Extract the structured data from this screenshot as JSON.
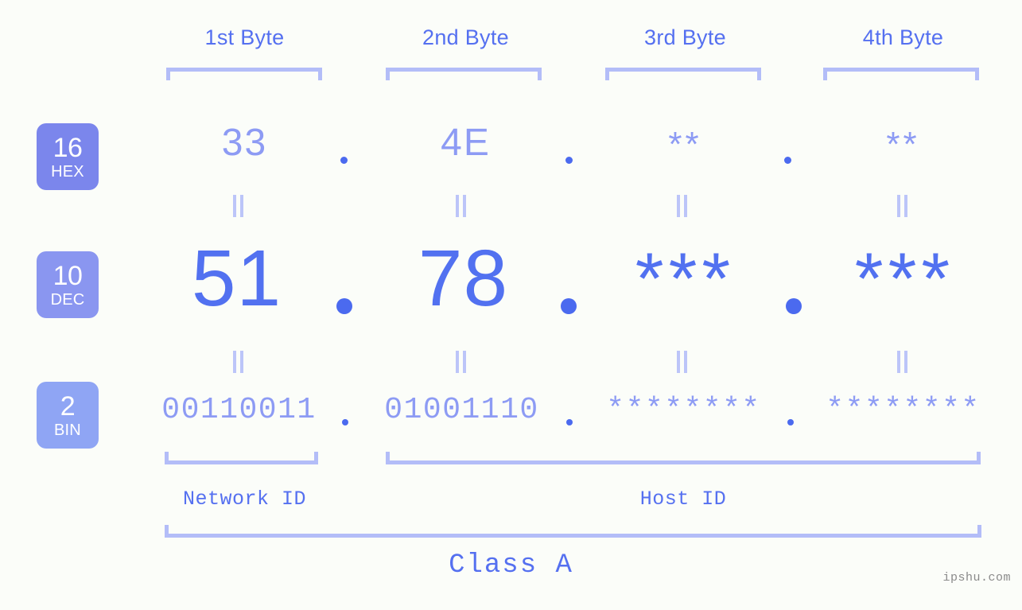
{
  "headers": [
    {
      "label": "1st Byte"
    },
    {
      "label": "2nd Byte"
    },
    {
      "label": "3rd Byte"
    },
    {
      "label": "4th Byte"
    }
  ],
  "bases": {
    "hex": {
      "number": "16",
      "name": "HEX",
      "color": "#7b86ec"
    },
    "dec": {
      "number": "10",
      "name": "DEC",
      "color": "#8a96f0"
    },
    "bin": {
      "number": "2",
      "name": "BIN",
      "color": "#8fa5f4"
    }
  },
  "rows": {
    "hex": {
      "values": [
        "33",
        "4E",
        "**",
        "**"
      ]
    },
    "dec": {
      "values": [
        "51",
        "78",
        "***",
        "***"
      ]
    },
    "bin": {
      "values": [
        "00110011",
        "01001110",
        "********",
        "********"
      ]
    }
  },
  "separator": ".",
  "equals": "=",
  "segments": {
    "network": {
      "label": "Network ID"
    },
    "host": {
      "label": "Host ID"
    }
  },
  "class": {
    "label": "Class A"
  },
  "watermark": {
    "text": "ipshu.com"
  },
  "colors": {
    "background": "#fbfdf9",
    "accent_strong": "#5271f0",
    "accent_mid": "#8d9bf4",
    "accent_light": "#b3bdf8",
    "dot": "#4b6aef",
    "watermark": "#8a8a8a"
  }
}
